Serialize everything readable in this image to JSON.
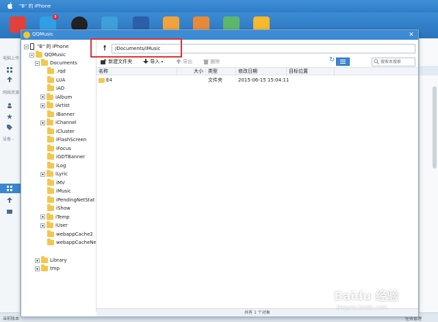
{
  "app": {
    "title": "\"B\" 的 iPhone",
    "status_left": "当前版本",
    "status_right": "任务管理",
    "sidebar_sections": [
      "电脑上传",
      "网络资源",
      "设备 -"
    ]
  },
  "toolbar_icons": [
    {
      "name": "itunes-store-icon",
      "color": "#e0413b"
    },
    {
      "name": "app-store-icon",
      "color": "#2f9fe6",
      "badge": "8"
    },
    {
      "name": "music-disc-icon",
      "color": "#222222"
    },
    {
      "name": "photos-icon",
      "color": "#3da0d8"
    },
    {
      "name": "video-clapper-icon",
      "color": "#2b5fa8"
    },
    {
      "name": "mail-icon",
      "color": "#f2a23b"
    },
    {
      "name": "books-icon",
      "color": "#e58a3a"
    },
    {
      "name": "pineapple-icon",
      "color": "#5db66b"
    },
    {
      "name": "tools-icon",
      "color": "#f5b82e"
    }
  ],
  "dialog": {
    "title": "QQMusic",
    "path": "/Documents/iMusic",
    "search_placeholder": "搜索本搜索",
    "toolbar": {
      "new_folder": "新建文件夹",
      "import": "导入",
      "export": "导出",
      "delete": "删除"
    },
    "columns": {
      "name": "名称",
      "size": "大小",
      "type": "类型",
      "modified": "修改日期",
      "target": "目标位置"
    },
    "rows": [
      {
        "name": "E4",
        "size": "",
        "type": "文件夹",
        "modified": "2015-06-15 15:04:11",
        "target": ""
      }
    ],
    "status": "共有 1 个对象"
  },
  "tree": {
    "device": "\"B\" 的 iPhone",
    "app": "QQMusic",
    "documents": "Documents",
    "documents_children": [
      {
        "label": ".rqd",
        "expandable": false
      },
      {
        "label": "LUA",
        "expandable": false
      },
      {
        "label": "iAD",
        "expandable": false
      },
      {
        "label": "iAlbum",
        "expandable": true
      },
      {
        "label": "iArtist",
        "expandable": true
      },
      {
        "label": "iBanner",
        "expandable": false
      },
      {
        "label": "iChannel",
        "expandable": true
      },
      {
        "label": "iCluster",
        "expandable": false
      },
      {
        "label": "iFlashScreen",
        "expandable": false
      },
      {
        "label": "iFocus",
        "expandable": false
      },
      {
        "label": "iGDTBanner",
        "expandable": false
      },
      {
        "label": "iLog",
        "expandable": false
      },
      {
        "label": "iLyric",
        "expandable": true
      },
      {
        "label": "iMV",
        "expandable": false
      },
      {
        "label": "iMusic",
        "expandable": false
      },
      {
        "label": "iPendingNetStat",
        "expandable": false
      },
      {
        "label": "iShow",
        "expandable": false
      },
      {
        "label": "iTemp",
        "expandable": true
      },
      {
        "label": "iUser",
        "expandable": true
      },
      {
        "label": "webappCache2",
        "expandable": false
      },
      {
        "label": "webappCacheNew",
        "expandable": false
      }
    ],
    "library": "Library",
    "tmp": "tmp"
  },
  "watermark": {
    "main": "Baidu 经验",
    "sub": "jingyan.baidu.com"
  }
}
